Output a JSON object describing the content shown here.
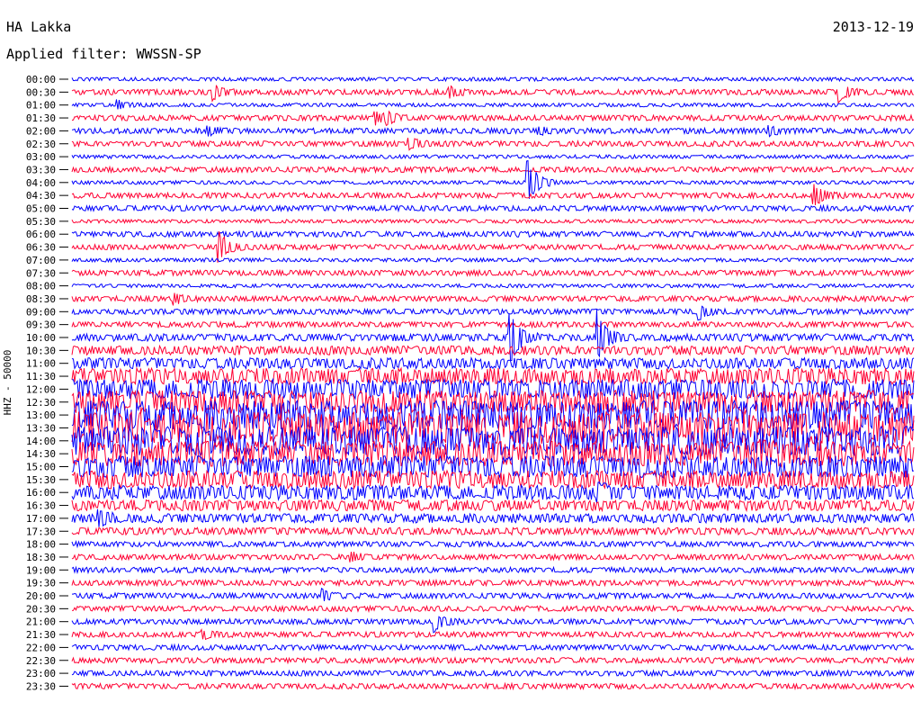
{
  "header": {
    "station": "HA Lakka",
    "date": "2013-12-19",
    "filter": "Applied filter: WWSSN-SP",
    "channel_label": "HHZ - 50000"
  },
  "colors": {
    "trace_a": "#0000ff",
    "trace_b": "#ff0033",
    "background": "#ffffff",
    "text": "#000000"
  },
  "chart_data": {
    "type": "line",
    "title": "HA Lakka",
    "subtitle": "Applied filter: WWSSN-SP",
    "ylabel": "HHZ - 50000",
    "date": "2013-12-19",
    "rows": [
      "00:00",
      "00:30",
      "01:00",
      "01:30",
      "02:00",
      "02:30",
      "03:00",
      "03:30",
      "04:00",
      "04:30",
      "05:00",
      "05:30",
      "06:00",
      "06:30",
      "07:00",
      "07:30",
      "08:00",
      "08:30",
      "09:00",
      "09:30",
      "10:00",
      "10:30",
      "11:00",
      "11:30",
      "12:00",
      "12:30",
      "13:00",
      "13:30",
      "14:00",
      "14:30",
      "15:00",
      "15:30",
      "16:00",
      "16:30",
      "17:00",
      "17:30",
      "18:00",
      "18:30",
      "19:00",
      "19:30",
      "20:00",
      "20:30",
      "21:00",
      "21:30",
      "22:00",
      "22:30",
      "23:00",
      "23:30"
    ],
    "row_minutes": 30,
    "noise_amplitude": [
      2,
      3,
      2,
      3,
      3,
      3,
      2,
      3,
      2,
      3,
      3,
      2,
      3,
      3,
      2,
      3,
      2,
      3,
      3,
      3,
      4,
      5,
      6,
      9,
      11,
      13,
      16,
      18,
      16,
      14,
      12,
      10,
      8,
      6,
      5,
      4,
      3,
      3,
      3,
      3,
      3,
      3,
      3,
      3,
      3,
      3,
      3,
      3
    ],
    "events": [
      {
        "row": "00:30",
        "minute": 5.0,
        "amplitude": 9
      },
      {
        "row": "00:30",
        "minute": 13.4,
        "amplitude": 6
      },
      {
        "row": "00:30",
        "minute": 27.3,
        "amplitude": 10
      },
      {
        "row": "01:00",
        "minute": 1.6,
        "amplitude": 5
      },
      {
        "row": "01:30",
        "minute": 10.8,
        "amplitude": 7
      },
      {
        "row": "01:30",
        "minute": 11.2,
        "amplitude": 6
      },
      {
        "row": "02:00",
        "minute": 4.8,
        "amplitude": 5
      },
      {
        "row": "02:00",
        "minute": 16.6,
        "amplitude": 4
      },
      {
        "row": "02:00",
        "minute": 24.8,
        "amplitude": 6
      },
      {
        "row": "02:30",
        "minute": 12.0,
        "amplitude": 7
      },
      {
        "row": "04:00",
        "minute": 16.2,
        "amplitude": 30
      },
      {
        "row": "04:30",
        "minute": 26.4,
        "amplitude": 14
      },
      {
        "row": "06:30",
        "minute": 5.2,
        "amplitude": 18
      },
      {
        "row": "08:30",
        "minute": 3.6,
        "amplitude": 6
      },
      {
        "row": "09:00",
        "minute": 22.3,
        "amplitude": 9
      },
      {
        "row": "10:00",
        "minute": 15.6,
        "amplitude": 30
      },
      {
        "row": "10:00",
        "minute": 18.7,
        "amplitude": 28
      },
      {
        "row": "14:30",
        "minute": 24.4,
        "amplitude": 6
      },
      {
        "row": "16:00",
        "minute": 18.7,
        "amplitude": 8
      },
      {
        "row": "17:00",
        "minute": 0.9,
        "amplitude": 10
      },
      {
        "row": "18:30",
        "minute": 9.9,
        "amplitude": 5
      },
      {
        "row": "20:00",
        "minute": 8.9,
        "amplitude": 6
      },
      {
        "row": "21:00",
        "minute": 12.9,
        "amplitude": 10
      },
      {
        "row": "21:30",
        "minute": 4.6,
        "amplitude": 5
      }
    ],
    "gridlines": false,
    "legend": "none"
  }
}
